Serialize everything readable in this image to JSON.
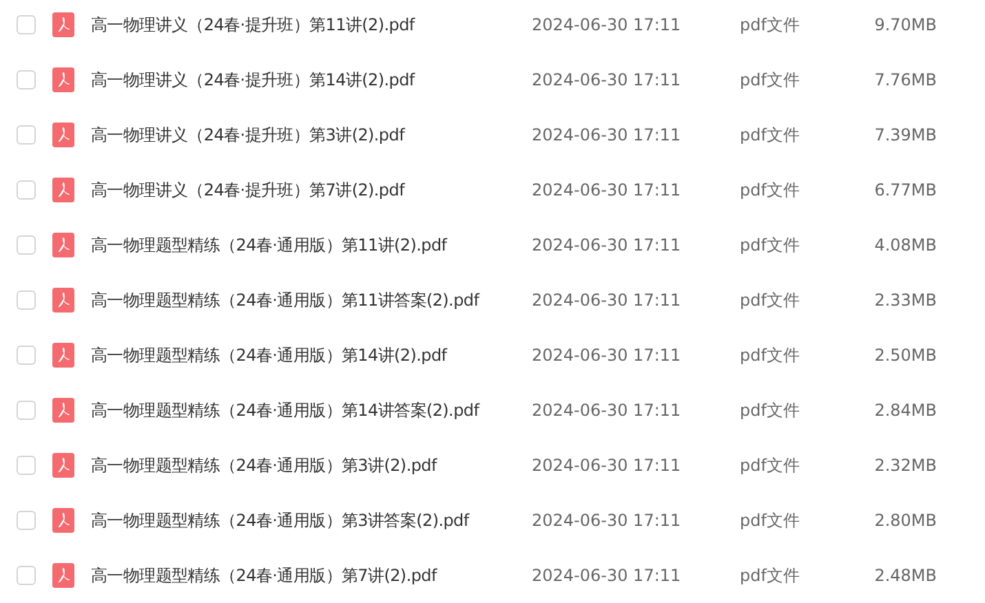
{
  "files": [
    {
      "name": "高一物理讲义（24春·提升班）第11讲(2).pdf",
      "modified": "2024-06-30 17:11",
      "type": "pdf文件",
      "size": "9.70MB",
      "checked": false
    },
    {
      "name": "高一物理讲义（24春·提升班）第14讲(2).pdf",
      "modified": "2024-06-30 17:11",
      "type": "pdf文件",
      "size": "7.76MB",
      "checked": false
    },
    {
      "name": "高一物理讲义（24春·提升班）第3讲(2).pdf",
      "modified": "2024-06-30 17:11",
      "type": "pdf文件",
      "size": "7.39MB",
      "checked": false
    },
    {
      "name": "高一物理讲义（24春·提升班）第7讲(2).pdf",
      "modified": "2024-06-30 17:11",
      "type": "pdf文件",
      "size": "6.77MB",
      "checked": false
    },
    {
      "name": "高一物理题型精练（24春·通用版）第11讲(2).pdf",
      "modified": "2024-06-30 17:11",
      "type": "pdf文件",
      "size": "4.08MB",
      "checked": false
    },
    {
      "name": "高一物理题型精练（24春·通用版）第11讲答案(2).pdf",
      "modified": "2024-06-30 17:11",
      "type": "pdf文件",
      "size": "2.33MB",
      "checked": false
    },
    {
      "name": "高一物理题型精练（24春·通用版）第14讲(2).pdf",
      "modified": "2024-06-30 17:11",
      "type": "pdf文件",
      "size": "2.50MB",
      "checked": false
    },
    {
      "name": "高一物理题型精练（24春·通用版）第14讲答案(2).pdf",
      "modified": "2024-06-30 17:11",
      "type": "pdf文件",
      "size": "2.84MB",
      "checked": false
    },
    {
      "name": "高一物理题型精练（24春·通用版）第3讲(2).pdf",
      "modified": "2024-06-30 17:11",
      "type": "pdf文件",
      "size": "2.32MB",
      "checked": false
    },
    {
      "name": "高一物理题型精练（24春·通用版）第3讲答案(2).pdf",
      "modified": "2024-06-30 17:11",
      "type": "pdf文件",
      "size": "2.80MB",
      "checked": false
    },
    {
      "name": "高一物理题型精练（24春·通用版）第7讲(2).pdf",
      "modified": "2024-06-30 17:11",
      "type": "pdf文件",
      "size": "2.48MB",
      "checked": false
    }
  ]
}
